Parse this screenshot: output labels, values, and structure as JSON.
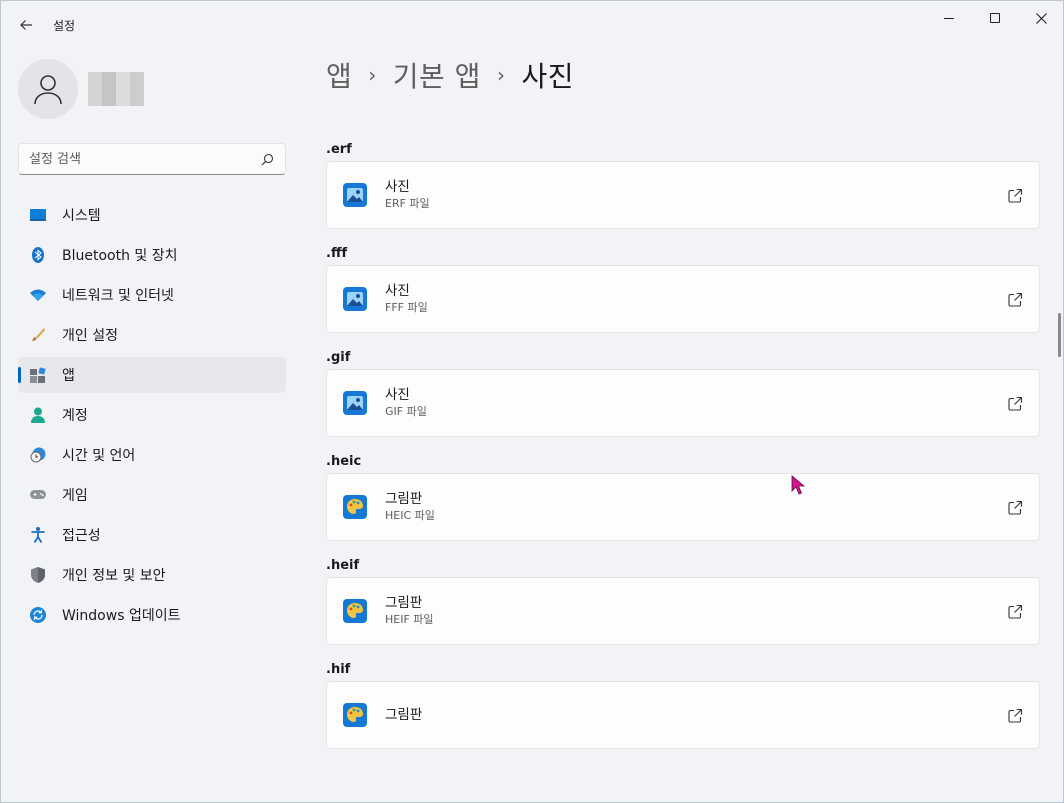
{
  "window": {
    "title": "설정"
  },
  "search": {
    "placeholder": "설정 검색"
  },
  "sidebar": {
    "items": [
      {
        "label": "시스템",
        "icon": "system-icon"
      },
      {
        "label": "Bluetooth 및 장치",
        "icon": "bluetooth-icon"
      },
      {
        "label": "네트워크 및 인터넷",
        "icon": "wifi-icon"
      },
      {
        "label": "개인 설정",
        "icon": "brush-icon"
      },
      {
        "label": "앱",
        "icon": "apps-icon",
        "active": true
      },
      {
        "label": "계정",
        "icon": "account-icon"
      },
      {
        "label": "시간 및 언어",
        "icon": "clock-globe-icon"
      },
      {
        "label": "게임",
        "icon": "gamepad-icon"
      },
      {
        "label": "접근성",
        "icon": "accessibility-icon"
      },
      {
        "label": "개인 정보 및 보안",
        "icon": "shield-icon"
      },
      {
        "label": "Windows 업데이트",
        "icon": "update-icon"
      }
    ]
  },
  "breadcrumb": {
    "items": [
      "앱",
      "기본 앱",
      "사진"
    ],
    "separator": "›"
  },
  "associations": [
    {
      "ext": ".erf",
      "app": "사진",
      "desc": "ERF 파일",
      "icon": "photos-icon"
    },
    {
      "ext": ".fff",
      "app": "사진",
      "desc": "FFF 파일",
      "icon": "photos-icon"
    },
    {
      "ext": ".gif",
      "app": "사진",
      "desc": "GIF 파일",
      "icon": "photos-icon"
    },
    {
      "ext": ".heic",
      "app": "그림판",
      "desc": "HEIC 파일",
      "icon": "paint-icon"
    },
    {
      "ext": ".heif",
      "app": "그림판",
      "desc": "HEIF 파일",
      "icon": "paint-icon"
    },
    {
      "ext": ".hif",
      "app": "그림판",
      "desc": "",
      "icon": "paint-icon"
    }
  ],
  "colors": {
    "accent": "#0067c0",
    "background": "#f1f3f7",
    "card": "#fdfdfd"
  }
}
